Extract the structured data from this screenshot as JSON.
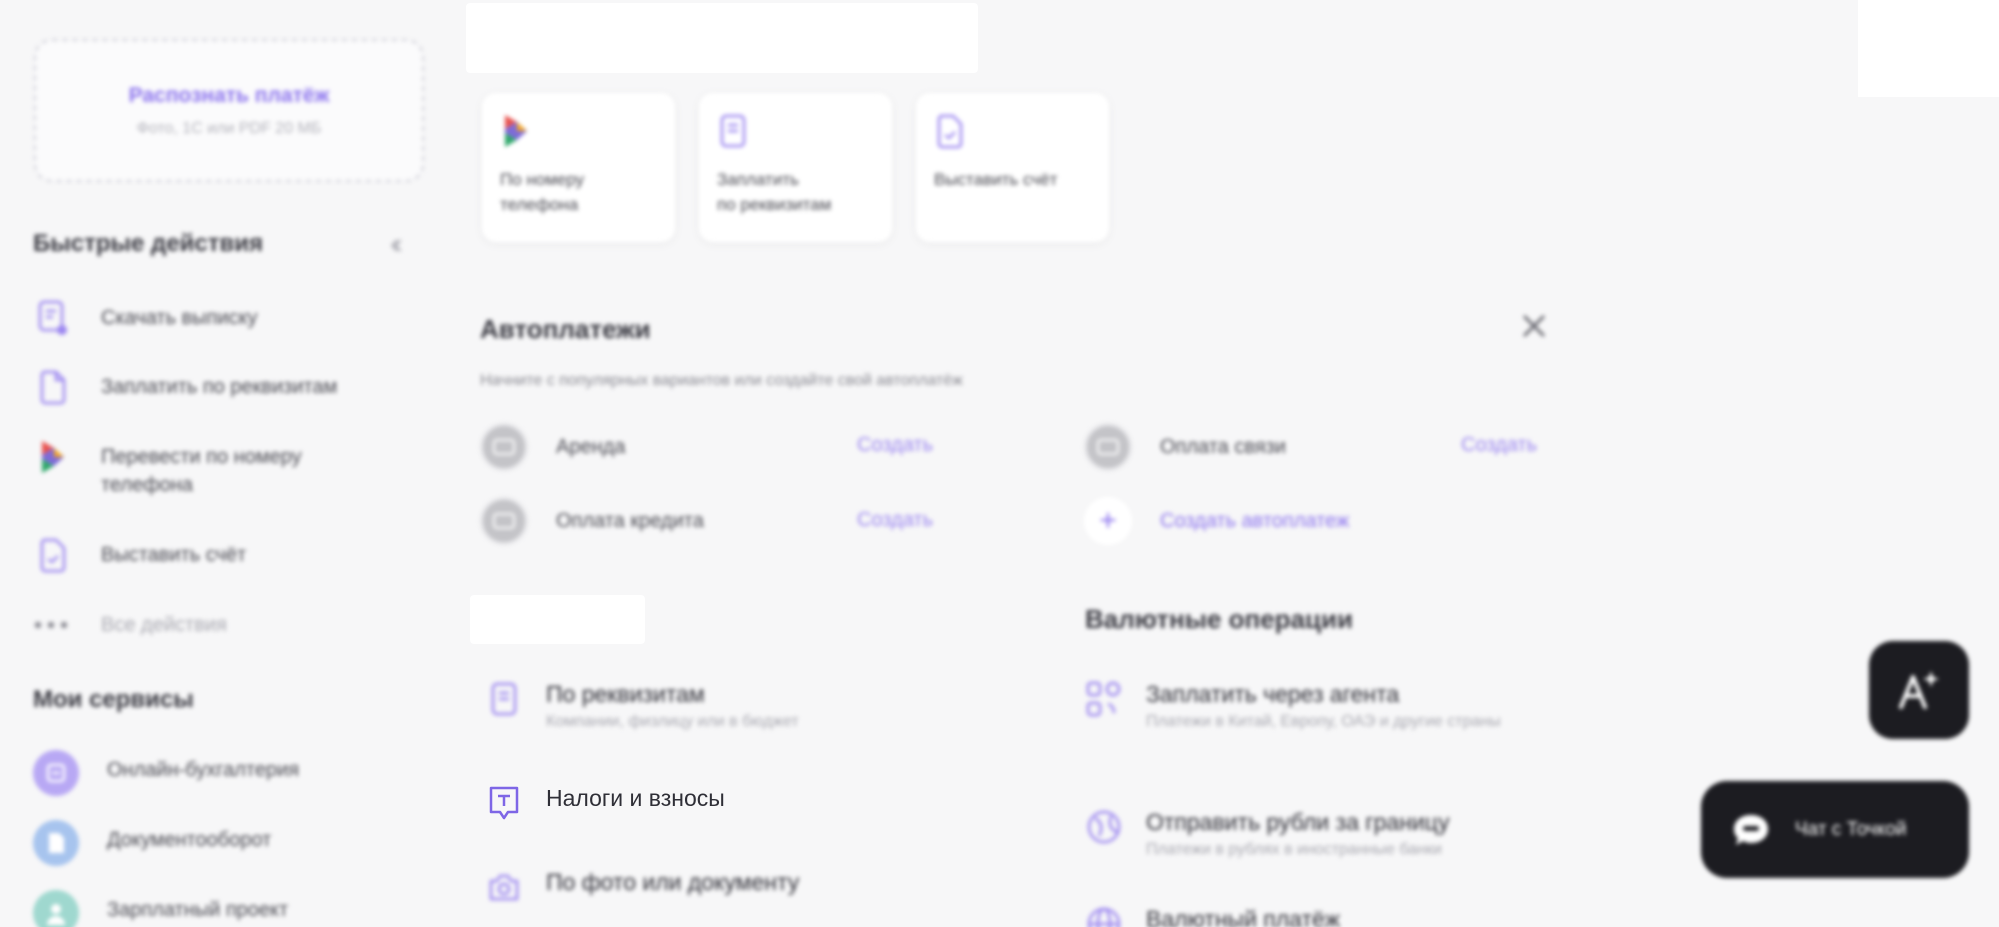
{
  "colors": {
    "accent": "#8c74ee",
    "background": "#f7f7f8",
    "floating_dark": "#1c1c21"
  },
  "sidebar": {
    "recognize": {
      "title": "Распознать платёж",
      "subtitle": "Фото, 1С или PDF 20 МБ"
    },
    "quick_actions_heading": "Быстрые действия",
    "quick_actions": [
      {
        "label": "Скачать выписку",
        "icon": "statement-download-icon"
      },
      {
        "label": "Заплатить по реквизитам",
        "icon": "document-icon"
      },
      {
        "label": "Перевести по номеру телефона",
        "icon": "sbp-icon"
      },
      {
        "label": "Выставить счёт",
        "icon": "invoice-icon"
      },
      {
        "label": "Все действия",
        "icon": "more-dots-icon"
      }
    ],
    "services_heading": "Мои сервисы",
    "services": [
      {
        "label": "Онлайн-бухгалтерия",
        "icon": "accounting-icon"
      },
      {
        "label": "Документооборот",
        "icon": "document-flow-icon"
      },
      {
        "label": "Зарплатный проект",
        "icon": "salary-project-icon"
      }
    ]
  },
  "quick_cards": [
    {
      "label": "По номеру\nтелефона",
      "icon": "sbp-icon"
    },
    {
      "label": "Заплатить\nпо реквизитам",
      "icon": "document-icon"
    },
    {
      "label": "Выставить счёт",
      "icon": "invoice-icon"
    }
  ],
  "autopay": {
    "title": "Автоплатежи",
    "subtitle": "Начните с популярных вариантов или создайте свой автоплатёж",
    "create_label": "Создать",
    "options": [
      {
        "label": "Аренда"
      },
      {
        "label": "Оплата связи"
      },
      {
        "label": "Оплата кредита"
      }
    ],
    "create_custom": "Создать автоплатеж"
  },
  "payments": [
    {
      "title": "По реквизитам",
      "subtitle": "Компании, физлицу или в бюджет",
      "icon": "document-icon"
    },
    {
      "title": "Налоги и взносы",
      "subtitle": "",
      "icon": "tax-icon"
    },
    {
      "title": "По фото или документу",
      "subtitle": "",
      "icon": "camera-icon"
    }
  ],
  "fx": {
    "heading": "Валютные операции",
    "items": [
      {
        "title": "Заплатить через агента",
        "subtitle": "Платежи в Китай, Европу, ОАЭ и другие страны",
        "icon": "agent-exchange-icon"
      },
      {
        "title": "Отправить рубли за границу",
        "subtitle": "Платежи в рублях в иностранные банки",
        "icon": "ruble-abroad-icon"
      },
      {
        "title": "Валютный платёж",
        "subtitle": "",
        "icon": "globe-icon"
      }
    ]
  },
  "chat": {
    "label": "Чат с Точкой"
  }
}
